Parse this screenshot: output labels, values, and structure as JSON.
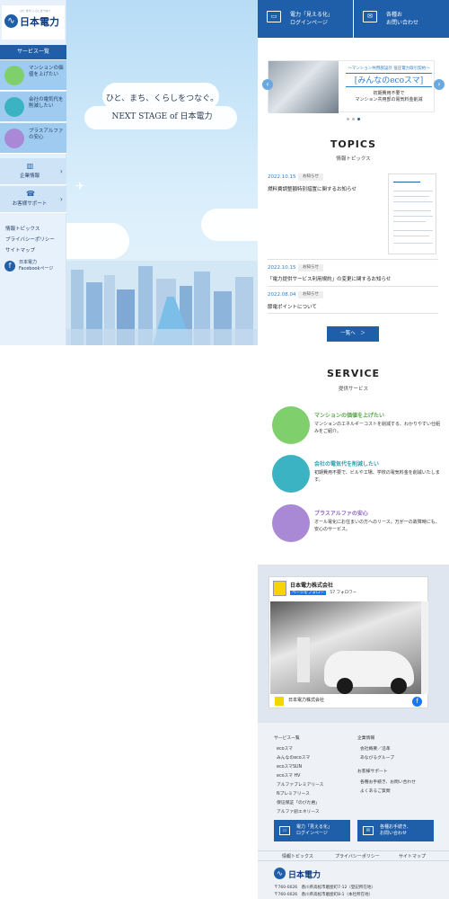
{
  "brand": {
    "name": "日本電力",
    "tagline_small": "ひと まち くらしをつなぐ",
    "accent": "#1f5ea8"
  },
  "sidebar": {
    "services_heading": "サービス一覧",
    "services": [
      {
        "label": "マンションの価値を上げたい",
        "icon": "building-icon",
        "color": "#7fcf6c"
      },
      {
        "label": "会社の電気代を削減したい",
        "icon": "office-icon",
        "color": "#3bb3c3"
      },
      {
        "label": "プラスアルファの安心",
        "icon": "family-icon",
        "color": "#a989d6"
      }
    ],
    "nav": [
      {
        "label": "企業情報",
        "icon": "building-small-icon"
      },
      {
        "label": "お客様サポート",
        "icon": "support-icon"
      }
    ],
    "links": [
      "情報トピックス",
      "プライバシーポリシー",
      "サイトマップ"
    ],
    "facebook_label_1": "日本電力",
    "facebook_label_2": "Facebookページ"
  },
  "hero": {
    "tagline": "ひと、まち、くらしをつなぐ。",
    "stage": "NEXT STAGE of 日本電力"
  },
  "header_buttons": {
    "login_line1": "電力「見える化」",
    "login_line2": "ログインページ",
    "contact_line1": "各種お",
    "contact_line2": "お問い合わせ"
  },
  "banner": {
    "line1": "〜マンション共用部設計 低圧電力取引契約〜",
    "line2": "[みんなのecoスマ]",
    "line3": "初期費用不要で",
    "line4": "マンション共用部の電気料金削減"
  },
  "topics": {
    "heading": "TOPICS",
    "subheading": "情報トピックス",
    "items": [
      {
        "date": "2022.10.15",
        "tag": "お知らせ",
        "title": "燃料費調整額特別措置に関するお知らせ"
      },
      {
        "date": "2022.10.15",
        "tag": "お知らせ",
        "title": "「電力提供サービス利用規約」の変更に関するお知らせ"
      },
      {
        "date": "2022.08.04",
        "tag": "お知らせ",
        "title": "節電ポイントについて"
      }
    ],
    "more": "一覧へ　＞"
  },
  "service": {
    "heading": "SERVICE",
    "subheading": "提供サービス",
    "items": [
      {
        "title": "マンションの価値を上げたい",
        "desc": "マンションのエネルギーコストを削減する、わかりやすい仕組みをご紹介。",
        "color": "#7fcf6c",
        "title_color": "#55a846"
      },
      {
        "title": "会社の電気代を削減したい",
        "desc": "初期費用不要で、ビルや工場、学校の電気料金を削減いたします。",
        "color": "#3bb3c3",
        "title_color": "#2f9fb0"
      },
      {
        "title": "プラスアルファの安心",
        "desc": "オール電化にお住まいの方へのリース。万が一の故障時にも、安心のサービス。",
        "color": "#a989d6",
        "title_color": "#8a67c0"
      }
    ]
  },
  "facebook": {
    "page_name": "日本電力株式会社",
    "follow": "ページをフォロー",
    "follow_count": "57 フォロワー",
    "post_name": "日本電力株式会社"
  },
  "footer": {
    "col1_heading": "サービス一覧",
    "col1_items": [
      "ecoスマ",
      "みんなのecoスマ",
      "ecoスマSUN",
      "ecoスマ HV",
      "アルファプレミアリース",
      "Nプレミアリース",
      "保证保証「のびた君」",
      "アルファ創エネリース"
    ],
    "col2_heading": "企業情報",
    "col2_items": [
      "会社概要／沿革",
      "あなびるグループ"
    ],
    "col3_heading": "お客様サポート",
    "col3_items": [
      "各種お手続き、お問い合わせ",
      "よくあるご質問"
    ],
    "login_line1": "電力「見える化」",
    "login_line2": "ログインページ",
    "contact_line1": "各種お手続き、",
    "contact_line2": "お問い合わせ",
    "links": [
      "情報トピックス",
      "プライバシーポリシー",
      "サイトマップ"
    ],
    "addr1": "〒760-0026　香川県高松市磨屋町7-12（登記所在地）",
    "addr2": "〒760-0026　香川県高松市磨屋町8-1（本社所在地）"
  }
}
